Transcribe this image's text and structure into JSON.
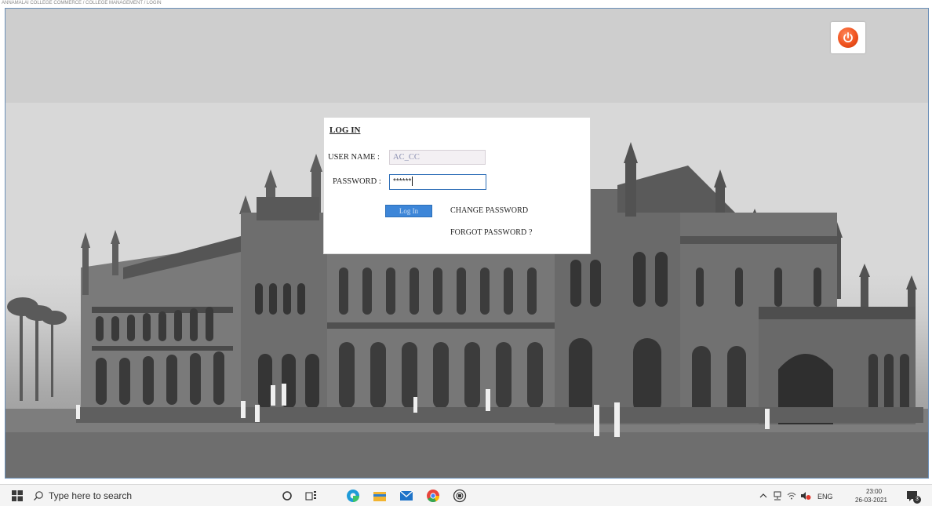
{
  "top_caption": "ANNAMALAI COLLEGE COMMERCE / COLLEGE MANAGEMENT / LOGIN",
  "login": {
    "title": "LOG IN",
    "username_label": "USER NAME :",
    "username_value": "AC_CC",
    "password_label": "PASSWORD :",
    "password_value": "******",
    "login_button": "Log In",
    "change_password": "CHANGE PASSWORD",
    "forgot_password": "FORGOT PASSWORD ?"
  },
  "power_button": {
    "icon": "power-icon",
    "color": "#f0521e"
  },
  "taskbar": {
    "search_placeholder": "Type here to search",
    "icons": [
      "windows-start-icon",
      "search-icon",
      "cortana-icon",
      "task-view-icon",
      "edge-icon",
      "file-explorer-icon",
      "mail-icon",
      "chrome-icon",
      "app-icon"
    ],
    "language": "ENG",
    "time": "23:00",
    "date": "26-03-2021",
    "notification_count": "3"
  },
  "colors": {
    "login_button": "#3d86d8",
    "taskbar": "#f4f4f4",
    "frame_border": "#6a8fb8"
  }
}
